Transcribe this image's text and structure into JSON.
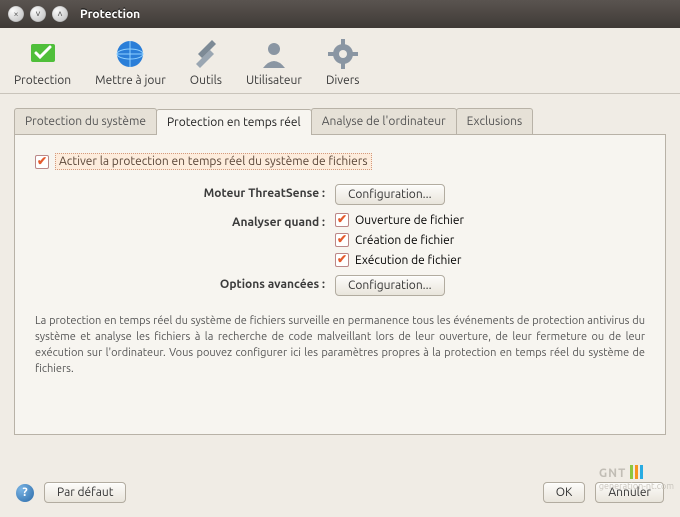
{
  "window": {
    "title": "Protection"
  },
  "toolbar": {
    "items": [
      {
        "label": "Protection"
      },
      {
        "label": "Mettre à jour"
      },
      {
        "label": "Outils"
      },
      {
        "label": "Utilisateur"
      },
      {
        "label": "Divers"
      }
    ]
  },
  "tabs": [
    {
      "label": "Protection du système"
    },
    {
      "label": "Protection en temps réel"
    },
    {
      "label": "Analyse de l'ordinateur"
    },
    {
      "label": "Exclusions"
    }
  ],
  "pane": {
    "enable_label": "Activer la protection en temps réel du système de fichiers",
    "engine_label": "Moteur ThreatSense :",
    "engine_button": "Configuration...",
    "scan_label": "Analyser quand :",
    "scan_opts": [
      "Ouverture de fichier",
      "Création de fichier",
      "Exécution de fichier"
    ],
    "advanced_label": "Options avancées :",
    "advanced_button": "Configuration...",
    "description": "La protection en temps réel du système de fichiers surveille en permanence tous les événements de protection antivirus du système et analyse les fichiers à la recherche de code malveillant lors de leur ouverture, de leur fermeture ou de leur exécution sur l'ordinateur. Vous pouvez configurer ici les paramètres propres à la protection en temps réel du système de fichiers."
  },
  "footer": {
    "default": "Par défaut",
    "ok": "OK",
    "cancel": "Annuler"
  },
  "watermark": {
    "brand": "GNT",
    "url": "generation-nt.com"
  }
}
